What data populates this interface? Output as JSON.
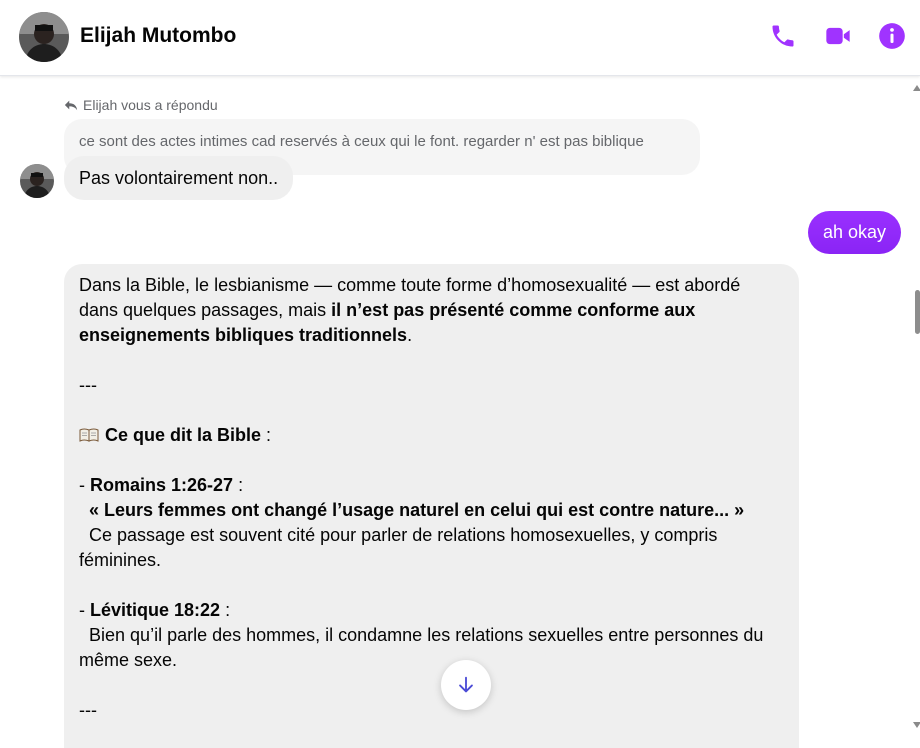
{
  "header": {
    "contact_name": "Elijah Mutombo",
    "icons": [
      "phone-icon",
      "video-call-icon",
      "info-icon"
    ],
    "accent_color": "#a033ff"
  },
  "chat": {
    "reply_hint": "Elijah vous a répondu",
    "quoted_message": "ce sont des actes intimes cad reservés à ceux qui le font. regarder n' est pas biblique",
    "incoming_reply": "Pas volontairement non..",
    "outgoing_message": "ah okay",
    "long_message": {
      "intro_plain": "Dans la Bible, le lesbianisme — comme toute forme d’homosexualité — est abordé dans quelques passages, mais ",
      "intro_bold": "il n’est pas présenté comme conforme aux enseignements bibliques traditionnels",
      "intro_end": ".",
      "separator_1": "---",
      "section_icon": "open-book-icon",
      "section_title": "Ce que dit la Bible",
      "section_colon": " :",
      "ref1_dash": "- ",
      "ref1_title": "Romains 1:26-27",
      "ref1_colon": " :",
      "ref1_quote": "« Leurs femmes ont changé l’usage naturel en celui qui est contre nature... »",
      "ref1_text": "Ce passage est souvent cité pour parler de relations homosexuelles, y compris féminines.",
      "ref2_dash": "- ",
      "ref2_title": "Lévitique 18:22",
      "ref2_colon": " :",
      "ref2_text": "Bien qu’il parle des hommes, il condamne les relations sexuelles entre personnes du même sexe.",
      "separator_2": "---"
    }
  },
  "controls": {
    "scroll_down_icon": "arrow-down-icon"
  }
}
